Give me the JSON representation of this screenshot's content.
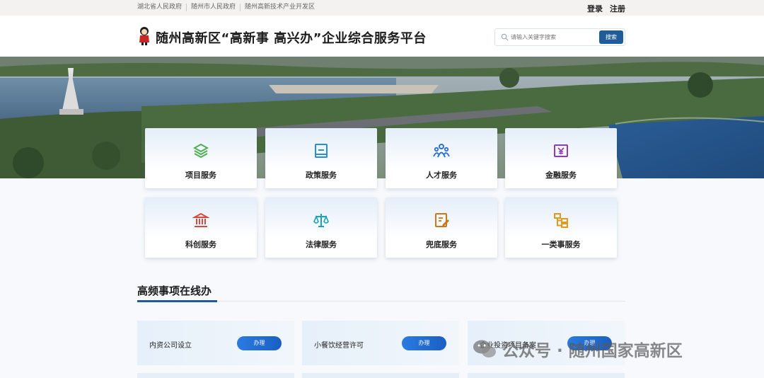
{
  "topbar": {
    "links": [
      "湖北省人民政府",
      "随州市人民政府",
      "随州高新技术产业开发区"
    ],
    "login": "登录",
    "register": "注册"
  },
  "header": {
    "title": "随州高新区“高新事 高兴办”企业综合服务平台",
    "search_placeholder": "请输入关键字搜索",
    "search_button": "搜索"
  },
  "services": [
    {
      "label": "项目服务",
      "icon": "layers-icon",
      "color": "#4caf50"
    },
    {
      "label": "政策服务",
      "icon": "book-icon",
      "color": "#2a8bd6"
    },
    {
      "label": "人才服务",
      "icon": "people-icon",
      "color": "#2a6fd6"
    },
    {
      "label": "金融服务",
      "icon": "yen-icon",
      "color": "#8e3bb5"
    },
    {
      "label": "科创服务",
      "icon": "institution-icon",
      "color": "#d9483b"
    },
    {
      "label": "法律服务",
      "icon": "scales-icon",
      "color": "#1aa3b8"
    },
    {
      "label": "兜底服务",
      "icon": "edit-document-icon",
      "color": "#c8791c"
    },
    {
      "label": "一类事服务",
      "icon": "flow-chart-icon",
      "color": "#e29a1c"
    }
  ],
  "section": {
    "title": "高频事项在线办"
  },
  "tasks": [
    {
      "name": "内资公司设立",
      "button": "办理"
    },
    {
      "name": "小餐饮经营许可",
      "button": "办理"
    },
    {
      "name": "企业投资项目备案",
      "button": "办理"
    }
  ],
  "watermark": "公众号 · 随州国家高新区"
}
